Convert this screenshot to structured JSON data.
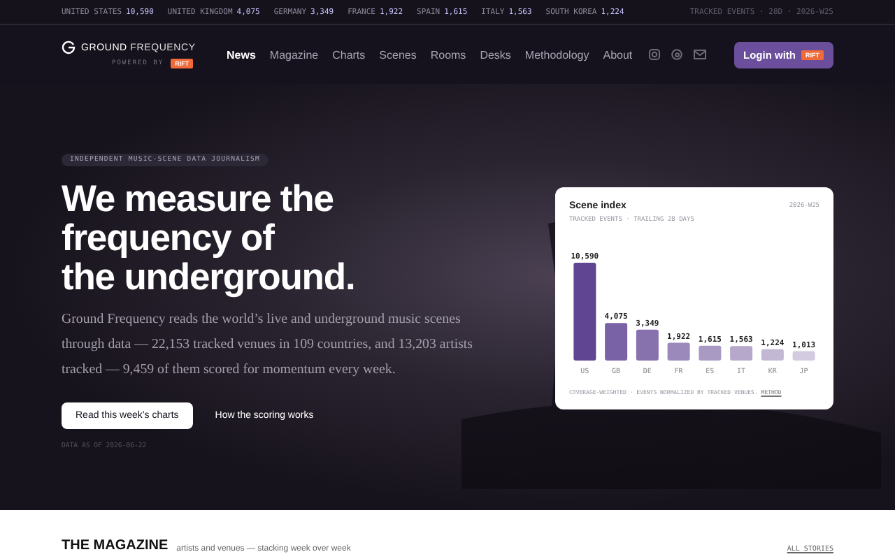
{
  "ticker": {
    "items": [
      {
        "country": "UNITED STATES",
        "count": "10,590"
      },
      {
        "country": "UNITED KINGDOM",
        "count": "4,075"
      },
      {
        "country": "GERMANY",
        "count": "3,349"
      },
      {
        "country": "FRANCE",
        "count": "1,922"
      },
      {
        "country": "SPAIN",
        "count": "1,615"
      },
      {
        "country": "ITALY",
        "count": "1,563"
      },
      {
        "country": "SOUTH KOREA",
        "count": "1,224"
      }
    ],
    "note": "TRACKED EVENTS · 28D · 2026-W25"
  },
  "nav": {
    "brand": {
      "name_bold": "GROUND",
      "name_light": "FREQUENCY",
      "powered_by": "POWERED BY",
      "powered_badge": "RIFT"
    },
    "links": [
      {
        "label": "News",
        "selected": true
      },
      {
        "label": "Magazine",
        "selected": false
      },
      {
        "label": "Charts",
        "selected": false
      },
      {
        "label": "Scenes",
        "selected": false
      },
      {
        "label": "Rooms",
        "selected": false
      },
      {
        "label": "Desks",
        "selected": false
      },
      {
        "label": "Methodology",
        "selected": false
      },
      {
        "label": "About",
        "selected": false
      }
    ],
    "login": {
      "label": "Login with",
      "badge": "RIFT"
    }
  },
  "hero": {
    "eyebrow": "INDEPENDENT MUSIC-SCENE DATA JOURNALISM",
    "headline": [
      "We measure the",
      "frequency of",
      "the underground."
    ],
    "body": "Ground Frequency reads the world’s live and underground music scenes through data — 22,153 tracked venues in 109 countries, and 13,203 artists tracked — 9,459 of them scored for momentum every week.",
    "primary_button": "Read this week’s charts",
    "secondary_link": "How the scoring works",
    "data_as_of": "DATA AS OF 2026-06-22"
  },
  "scene_card": {
    "title": "Scene index",
    "week": "2026-W25",
    "subtitle": "TRACKED EVENTS · TRAILING 28 DAYS",
    "chart_data": {
      "type": "bar",
      "categories": [
        "US",
        "GB",
        "DE",
        "FR",
        "ES",
        "IT",
        "KR",
        "JP"
      ],
      "values": [
        10590,
        4075,
        3349,
        1922,
        1615,
        1563,
        1224,
        1013
      ],
      "value_labels": [
        "10,590",
        "4,075",
        "3,349",
        "1,922",
        "1,615",
        "1,563",
        "1,224",
        "1,013"
      ]
    },
    "footnote": "COVERAGE-WEIGHTED · EVENTS NORMALIZED BY TRACKED VENUES.",
    "footnote_link": "METHOD"
  },
  "magazine": {
    "title": "THE MAGAZINE",
    "subtitle": "artists and venues — stacking week over week",
    "link": "ALL STORIES"
  }
}
